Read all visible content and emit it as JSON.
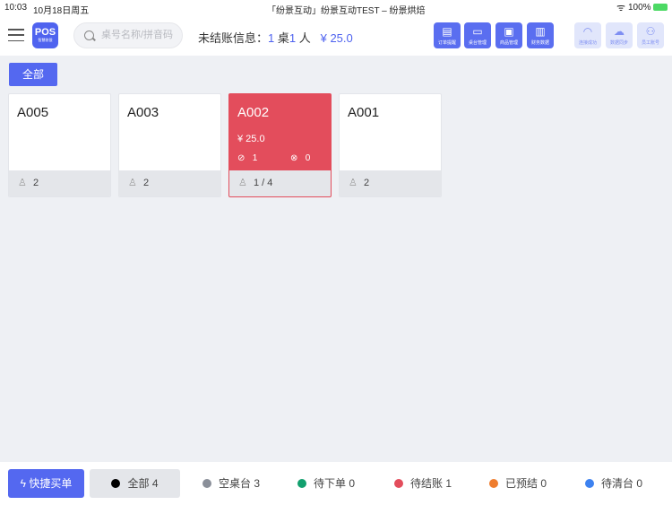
{
  "status_bar": {
    "time": "10:03",
    "date": "10月18日周五",
    "title": "「纷景互动」纷景互动TEST – 纷景烘焙",
    "battery": "100%"
  },
  "header": {
    "logo": "POS",
    "logo_sub": "智慧收银",
    "search_placeholder": "桌号名称/拼音码",
    "unpaid_label": "未结账信息：",
    "tables": "1",
    "tables_unit": "桌",
    "people": "1",
    "people_unit": "人",
    "amount": "¥ 25.0",
    "actions": [
      {
        "label": "订单提醒",
        "icon": "order-icon"
      },
      {
        "label": "桌台管理",
        "icon": "table-icon"
      },
      {
        "label": "商品管理",
        "icon": "goods-icon"
      },
      {
        "label": "财务数据",
        "icon": "finance-icon"
      }
    ],
    "system": [
      {
        "label": "连接成功",
        "icon": "wifi-icon"
      },
      {
        "label": "数据同步",
        "icon": "cloud-sync-icon"
      },
      {
        "label": "员工账号",
        "icon": "user-icon"
      }
    ]
  },
  "area_filter": "全部",
  "tables": [
    {
      "name": "A005",
      "seats": "2"
    },
    {
      "name": "A003",
      "seats": "2"
    },
    {
      "name": "A002",
      "amount": "¥ 25.0",
      "done": "1",
      "cancel": "0",
      "seats": "1 / 4",
      "status_color": "#e34d5c"
    },
    {
      "name": "A001",
      "seats": "2"
    }
  ],
  "bottom": {
    "quick_order": "快捷买单",
    "filters": [
      {
        "label": "全部",
        "count": "4",
        "color": "#000000"
      },
      {
        "label": "空桌台",
        "count": "3",
        "color": "#8a8f99"
      },
      {
        "label": "待下单",
        "count": "0",
        "color": "#12a06e"
      },
      {
        "label": "待结账",
        "count": "1",
        "color": "#e34d5c"
      },
      {
        "label": "已预结",
        "count": "0",
        "color": "#ef7d2e"
      },
      {
        "label": "待清台",
        "count": "0",
        "color": "#3d82f0"
      }
    ]
  }
}
